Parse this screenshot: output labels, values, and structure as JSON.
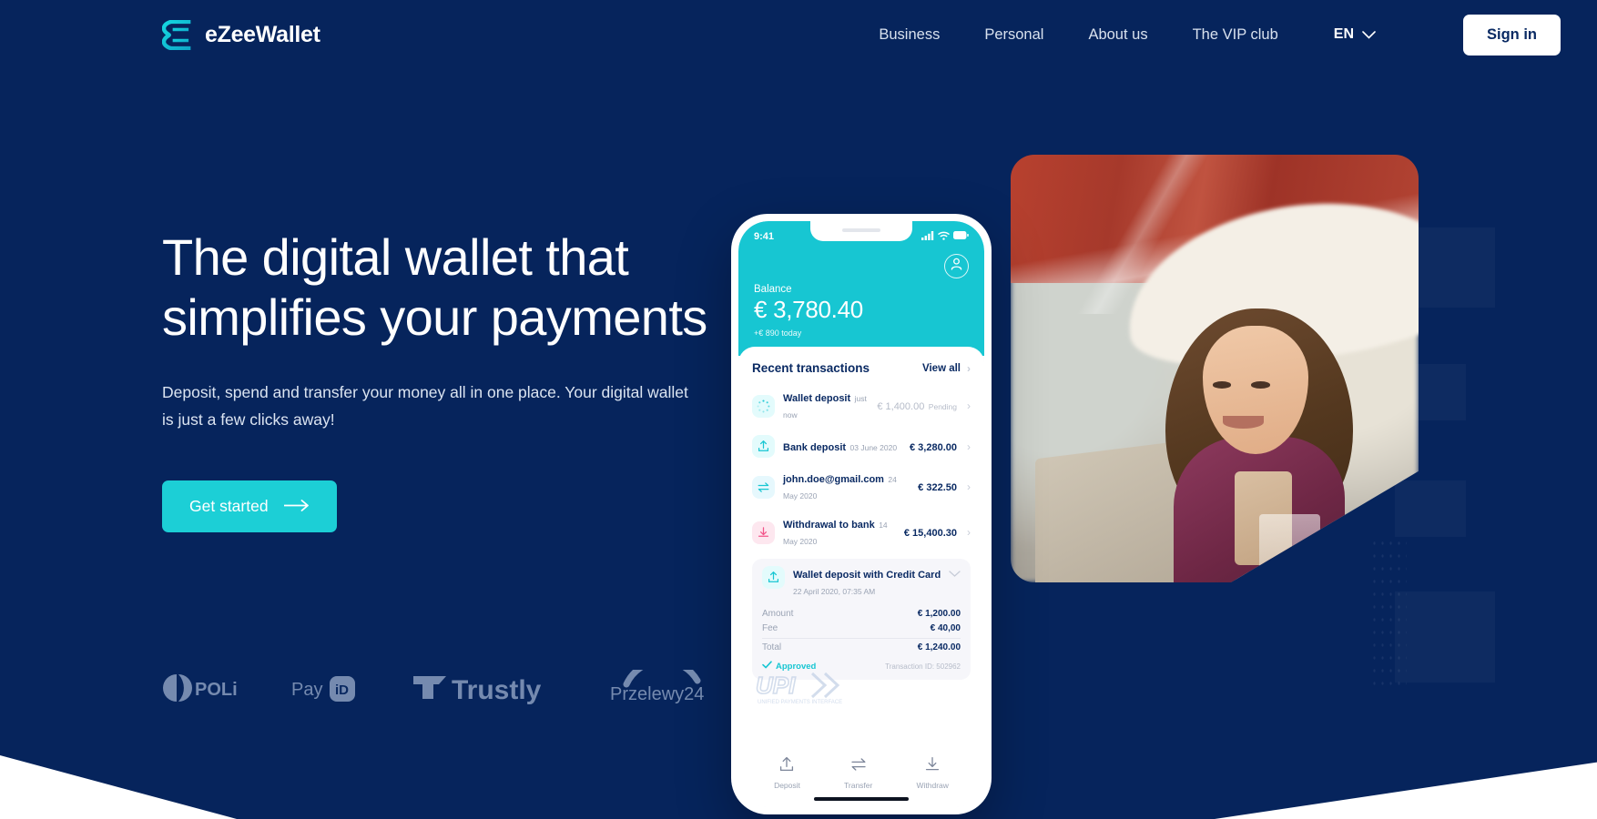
{
  "brand": {
    "name": "eZeeWallet",
    "logo_icon": "ezeewallet-logo-icon",
    "accent": "#1ccfd6",
    "navy": "#06245c"
  },
  "nav": {
    "links": [
      {
        "label": "Business"
      },
      {
        "label": "Personal"
      },
      {
        "label": "About us"
      },
      {
        "label": "The VIP club"
      }
    ],
    "language": {
      "value": "EN",
      "chevron_icon": "chevron-down-icon"
    },
    "signin_label": "Sign in"
  },
  "hero": {
    "headline": "The digital wallet that simplifies your payments",
    "subline": "Deposit, spend and transfer your money all in one place. Your digital wallet is just a few clicks away!",
    "cta_label": "Get started",
    "cta_icon": "arrow-right-icon"
  },
  "partners": [
    {
      "name": "POLi",
      "icon": "poli-logo-icon"
    },
    {
      "name": "PayID",
      "icon": "payid-logo-icon"
    },
    {
      "name": "Trustly",
      "icon": "trustly-logo-icon"
    },
    {
      "name": "Przelewy24",
      "icon": "przelewy24-logo-icon"
    },
    {
      "name": "UPI",
      "sub": "UNIFIED PAYMENTS INTERFACE",
      "icon": "upi-logo-icon"
    }
  ],
  "phone": {
    "status": {
      "time": "9:41",
      "signal_icon": "cellular-signal-icon",
      "wifi_icon": "wifi-icon",
      "battery_icon": "battery-icon"
    },
    "avatar_icon": "user-avatar-icon",
    "balance": {
      "label": "Balance",
      "amount": "€ 3,780.40",
      "today": "+€ 890 today"
    },
    "transactions": {
      "title": "Recent transactions",
      "view_all": "View all",
      "chevron_icon": "chevron-right-icon",
      "items": [
        {
          "name": "Wallet deposit",
          "date": "just now",
          "amount": "€ 1,400.00",
          "status": "Pending",
          "icon": "spinner-pending-icon",
          "muted": true
        },
        {
          "name": "Bank deposit",
          "date": "03 June 2020",
          "amount": "€ 3,280.00",
          "status": "",
          "icon": "upload-arrow-icon",
          "muted": false
        },
        {
          "name": "john.doe@gmail.com",
          "date": "24 May 2020",
          "amount": "€ 322.50",
          "status": "",
          "icon": "transfer-swap-icon",
          "muted": false
        },
        {
          "name": "Withdrawal to bank",
          "date": "14 May 2020",
          "amount": "€ 15,400.30",
          "status": "",
          "icon": "download-arrow-icon",
          "muted": false
        }
      ],
      "expanded": {
        "name": "Wallet deposit with Credit Card",
        "date": "22 April 2020, 07:35 AM",
        "icon": "upload-arrow-icon",
        "collapse_icon": "chevron-up-icon",
        "rows": [
          {
            "key": "Amount",
            "value": "€ 1,200.00"
          },
          {
            "key": "Fee",
            "value": "€ 40,00"
          },
          {
            "key": "Total",
            "value": "€ 1,240.00"
          }
        ],
        "status_label": "Approved",
        "status_icon": "check-icon",
        "transaction_id": "Transaction ID: 502962"
      }
    },
    "tabs": [
      {
        "label": "Deposit",
        "icon": "upload-arrow-icon"
      },
      {
        "label": "Transfer",
        "icon": "transfer-swap-icon"
      },
      {
        "label": "Withdraw",
        "icon": "download-arrow-icon"
      }
    ]
  },
  "photo": {
    "alt_name": "woman-with-phone-and-laptop-photo"
  }
}
